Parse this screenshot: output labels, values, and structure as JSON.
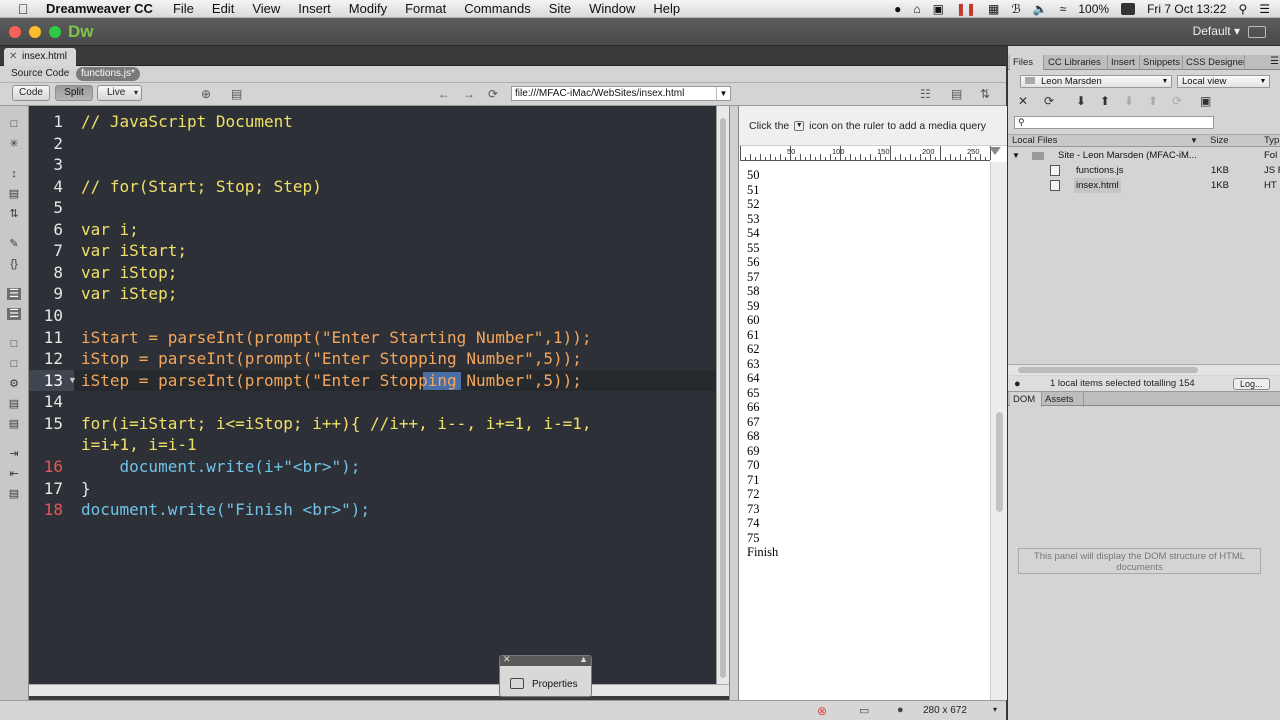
{
  "menubar": {
    "app": "Dreamweaver CC",
    "items": [
      "File",
      "Edit",
      "View",
      "Insert",
      "Modify",
      "Format",
      "Commands",
      "Site",
      "Window",
      "Help"
    ],
    "battery": "100%",
    "clock": "Fri 7 Oct  13:22"
  },
  "window": {
    "app_logo": "Dw",
    "workspace": "Default",
    "doc_tab": "insex.html"
  },
  "related_files": {
    "label": "Source Code",
    "file": "functions.js*"
  },
  "toolbar": {
    "code_label": "Code",
    "split_label": "Split",
    "live_label": "Live",
    "url": "file:///MFAC-iMac/WebSites/insex.html"
  },
  "code": {
    "lines": [
      {
        "n": "1",
        "text": "// JavaScript Document"
      },
      {
        "n": "2",
        "text": ""
      },
      {
        "n": "3",
        "text": ""
      },
      {
        "n": "4",
        "text": "// for(Start; Stop; Step)"
      },
      {
        "n": "5",
        "text": ""
      },
      {
        "n": "6",
        "text": "var i;"
      },
      {
        "n": "7",
        "text": "var iStart;"
      },
      {
        "n": "8",
        "text": "var iStop;"
      },
      {
        "n": "9",
        "text": "var iStep;"
      },
      {
        "n": "10",
        "text": ""
      },
      {
        "n": "11",
        "text": "iStart = parseInt(prompt(\"Enter Starting Number\",1));"
      },
      {
        "n": "12",
        "text": "iStop = parseInt(prompt(\"Enter Stopping Number\",5));"
      },
      {
        "n": "13",
        "text": "iStep = parseInt(prompt(\"Enter Stopping Number\",5));"
      },
      {
        "n": "14",
        "text": ""
      },
      {
        "n": "15",
        "text": "for(i=iStart; i<=iStop; i++){ //i++, i--, i+=1, i-=1,"
      },
      {
        "n": "",
        "text": "i=i+1, i=i-1"
      },
      {
        "n": "16",
        "text": "    document.write(i+\"<br>\");"
      },
      {
        "n": "17",
        "text": "}"
      },
      {
        "n": "18",
        "text": "document.write(\"Finish <br>\");"
      }
    ]
  },
  "live_view": {
    "media_hint_before": "Click the",
    "media_hint_after": "icon on the ruler to add a media query",
    "ruler_labels": [
      "0",
      "50",
      "100",
      "150",
      "200",
      "250"
    ],
    "output_lines": [
      "50",
      "51",
      "52",
      "53",
      "54",
      "55",
      "56",
      "57",
      "58",
      "59",
      "60",
      "61",
      "62",
      "63",
      "64",
      "65",
      "66",
      "67",
      "68",
      "69",
      "70",
      "71",
      "72",
      "73",
      "74",
      "75",
      "Finish"
    ],
    "dimensions": "280 x 672"
  },
  "properties_panel": {
    "label": "Properties"
  },
  "files_panel": {
    "tabs": [
      "Files",
      "CC Libraries",
      "Insert",
      "Snippets",
      "CSS Designer"
    ],
    "site_select": "Leon Marsden",
    "view_select": "Local view",
    "header_name": "Local Files",
    "header_size": "Size",
    "header_type": "Typ",
    "site_row": "Site - Leon Marsden (MFAC-iM...",
    "site_type": "Fol",
    "files": [
      {
        "name": "functions.js",
        "size": "1KB",
        "type": "JS F"
      },
      {
        "name": "insex.html",
        "size": "1KB",
        "type": "HT"
      }
    ],
    "status": "1 local items selected totalling 154",
    "log_button": "Log..."
  },
  "dom_panel": {
    "tabs": [
      "DOM",
      "Assets"
    ],
    "message": "This panel will display the DOM structure of HTML documents"
  }
}
